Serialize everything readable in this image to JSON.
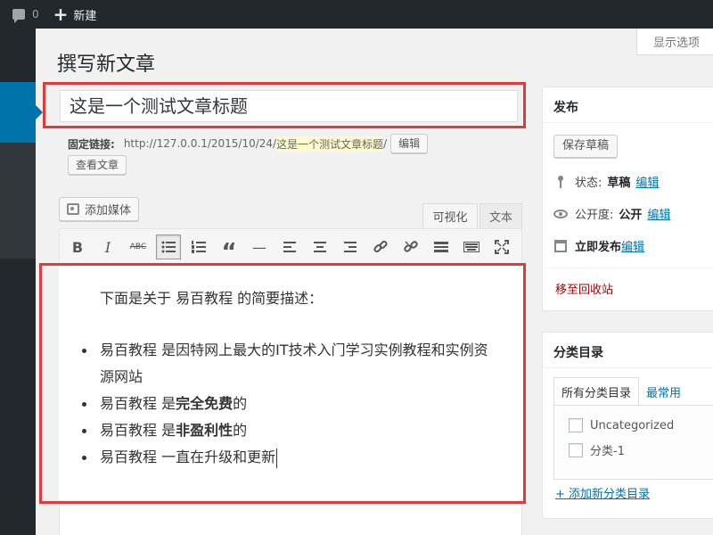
{
  "adminbar": {
    "comments_count": "0",
    "new_label": "新建"
  },
  "screen_options": "显示选项",
  "page_title": "撰写新文章",
  "post_title": "这是一个测试文章标题",
  "permalink": {
    "label": "固定链接:",
    "url_base": "http://127.0.0.1/2015/10/24/",
    "slug": "这是一个测试文章标题",
    "trailing": "/",
    "edit_button": "编辑",
    "view_button": "查看文章"
  },
  "editor": {
    "add_media": "添加媒体",
    "tab_visual": "可视化",
    "tab_text": "文本",
    "toolbar": {
      "bold": "B",
      "italic": "I",
      "strikethrough": "ABC",
      "bullet_list": "bullet-list-icon",
      "numbered_list": "numbered-list-icon",
      "quote": "“",
      "hr": "—"
    },
    "content": {
      "intro": "下面是关于 易百教程 的简要描述：",
      "items": [
        {
          "pre": "易百教程 是因特网上最大的IT技术入门学习实例教程和实例资源网站",
          "bold": "",
          "post": ""
        },
        {
          "pre": "易百教程 是",
          "bold": "完全免费",
          "post": "的"
        },
        {
          "pre": "易百教程 是",
          "bold": "非盈利性",
          "post": "的"
        },
        {
          "pre": "易百教程 一直在升级和更新",
          "bold": "",
          "post": ""
        }
      ]
    }
  },
  "publish": {
    "title": "发布",
    "save_draft": "保存草稿",
    "status_label": "状态:",
    "status_value": "草稿",
    "status_edit": "编辑",
    "visibility_label": "公开度:",
    "visibility_value": "公开",
    "visibility_edit": "编辑",
    "schedule_label": "立即发布",
    "schedule_edit": "编辑",
    "trash": "移至回收站"
  },
  "categories": {
    "title": "分类目录",
    "tab_all": "所有分类目录",
    "tab_popular": "最常用",
    "items": [
      "Uncategorized",
      "分类-1"
    ],
    "add_new": "+ 添加新分类目录"
  },
  "colors": {
    "highlight_border": "#e03a3a",
    "admin_bar": "#23282d",
    "accent": "#0073aa",
    "trash": "#aa0000"
  }
}
